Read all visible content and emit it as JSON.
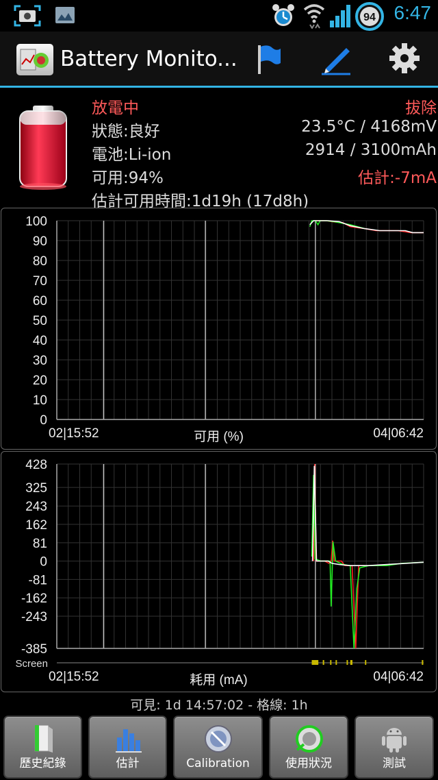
{
  "status_bar": {
    "time": "6:47",
    "battery_level": "94"
  },
  "action_bar": {
    "title": "Battery Monito..."
  },
  "summary": {
    "state": "放電中",
    "plug": "拔除",
    "health": "狀態:良好",
    "temp_voltage": "23.5°C / 4168mV",
    "type": "電池:Li-ion",
    "capacity": "2914 / 3100mAh",
    "available": "可用:94%",
    "estimate": "估計:-7mA",
    "remaining": "估計可用時間:1d19h (17d8h)"
  },
  "chart_data": [
    {
      "type": "line",
      "xlabel": "可用 (%)",
      "x_start": "02|15:52",
      "x_end": "04|06:42",
      "ylim": [
        0,
        100
      ],
      "yticks": [
        "100",
        "90",
        "80",
        "70",
        "60",
        "50",
        "40",
        "30",
        "20",
        "10",
        "0"
      ],
      "grid": true,
      "series": [
        {
          "color": "#ff2020",
          "points": [
            [
              0.705,
              100
            ],
            [
              0.735,
              100
            ],
            [
              0.75,
              99.5
            ],
            [
              0.78,
              99
            ],
            [
              0.8,
              97
            ],
            [
              0.84,
              96
            ],
            [
              0.87,
              95
            ],
            [
              0.93,
              95
            ],
            [
              0.965,
              94
            ],
            [
              1.0,
              94
            ]
          ]
        },
        {
          "color": "#22ee22",
          "points": [
            [
              0.69,
              97
            ],
            [
              0.695,
              100
            ],
            [
              0.705,
              100
            ],
            [
              0.712,
              98
            ],
            [
              0.718,
              100
            ],
            [
              0.735,
              100
            ],
            [
              0.755,
              99.5
            ],
            [
              0.8,
              98
            ],
            [
              0.84,
              96
            ]
          ]
        },
        {
          "color": "#ffffff",
          "points": [
            [
              0.69,
              98
            ],
            [
              0.7,
              100
            ],
            [
              0.74,
              100
            ],
            [
              0.77,
              99.5
            ],
            [
              0.8,
              97.5
            ],
            [
              0.84,
              96
            ],
            [
              0.88,
              95
            ],
            [
              0.95,
              95
            ],
            [
              0.97,
              94
            ],
            [
              1.0,
              94
            ]
          ]
        }
      ]
    },
    {
      "type": "line",
      "xlabel": "耗用 (mA)",
      "x_start": "02|15:52",
      "x_end": "04|06:42",
      "ylim": [
        -385,
        428
      ],
      "yticks": [
        "428",
        "325",
        "243",
        "162",
        "81",
        "0",
        "-81",
        "-162",
        "-243",
        "-385"
      ],
      "ytick_values": [
        428,
        325,
        243,
        162,
        81,
        0,
        -81,
        -162,
        -243,
        -385
      ],
      "screen_label": "Screen",
      "grid": true,
      "series": [
        {
          "color": "#ff2020",
          "points": [
            [
              0.7,
              0
            ],
            [
              0.703,
              428
            ],
            [
              0.707,
              0
            ],
            [
              0.73,
              0
            ],
            [
              0.742,
              -10
            ],
            [
              0.748,
              0
            ],
            [
              0.752,
              90
            ],
            [
              0.756,
              0
            ],
            [
              0.776,
              0
            ],
            [
              0.785,
              -20
            ],
            [
              0.805,
              -20
            ],
            [
              0.815,
              -385
            ],
            [
              0.823,
              -20
            ],
            [
              0.84,
              -20
            ]
          ]
        },
        {
          "color": "#22ee22",
          "points": [
            [
              0.695,
              20
            ],
            [
              0.7,
              380
            ],
            [
              0.704,
              10
            ],
            [
              0.72,
              0
            ],
            [
              0.745,
              0
            ],
            [
              0.748,
              -200
            ],
            [
              0.753,
              85
            ],
            [
              0.76,
              0
            ],
            [
              0.78,
              -15
            ],
            [
              0.8,
              -20
            ],
            [
              0.81,
              -385
            ],
            [
              0.818,
              -120
            ],
            [
              0.826,
              -30
            ],
            [
              0.85,
              -20
            ],
            [
              0.9,
              -20
            ],
            [
              0.94,
              -10
            ],
            [
              1.0,
              -5
            ]
          ]
        },
        {
          "color": "#ffffff",
          "points": [
            [
              0.697,
              0
            ],
            [
              0.702,
              420
            ],
            [
              0.708,
              0
            ],
            [
              0.74,
              0
            ],
            [
              0.75,
              -10
            ],
            [
              0.77,
              -15
            ],
            [
              0.8,
              -20
            ],
            [
              0.82,
              -20
            ],
            [
              0.85,
              -20
            ],
            [
              0.9,
              -15
            ],
            [
              0.95,
              -10
            ],
            [
              1.0,
              -5
            ]
          ]
        }
      ]
    }
  ],
  "footer": {
    "visible": "可見: 1d 14:57:02 - 格線: 1h"
  },
  "buttons": [
    {
      "label": "歷史紀錄",
      "icon": "history-icon"
    },
    {
      "label": "估計",
      "icon": "estimate-icon"
    },
    {
      "label": "Calibration",
      "icon": "calibration-icon"
    },
    {
      "label": "使用狀況",
      "icon": "usage-icon"
    },
    {
      "label": "測試",
      "icon": "android-icon"
    }
  ]
}
